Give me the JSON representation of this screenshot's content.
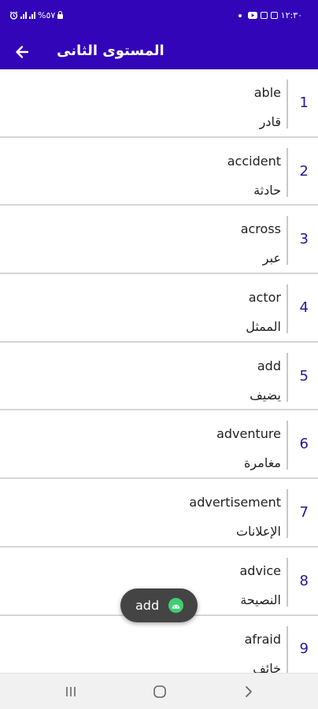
{
  "statusbar": {
    "time": "١٢:٣٠",
    "battery": "%٥٧",
    "icons": [
      "alarm-icon",
      "signal-icon",
      "signal-icon",
      "lock-icon",
      "gallery-icon",
      "instagram-icon",
      "youtube-icon",
      "notification-dot-icon"
    ]
  },
  "appbar": {
    "title": "المستوى الثانى",
    "back_icon": "arrow-left-icon",
    "background": "#3305b9"
  },
  "words": [
    {
      "num": "1",
      "en": "able",
      "ar": "قادر"
    },
    {
      "num": "2",
      "en": "accident",
      "ar": "حادثة"
    },
    {
      "num": "3",
      "en": "across",
      "ar": "عبر"
    },
    {
      "num": "4",
      "en": "actor",
      "ar": "الممثل"
    },
    {
      "num": "5",
      "en": "add",
      "ar": "يضيف"
    },
    {
      "num": "6",
      "en": "adventure",
      "ar": "مغامرة"
    },
    {
      "num": "7",
      "en": "advertisement",
      "ar": "الإعلانات"
    },
    {
      "num": "8",
      "en": "advice",
      "ar": "النصيحة"
    },
    {
      "num": "9",
      "en": "afraid",
      "ar": "خائف"
    }
  ],
  "fab": {
    "label": "add",
    "icon": "android-icon",
    "background": "#444444",
    "icon_color": "#3ecf72"
  },
  "navbar": {
    "items": [
      "recent-apps-icon",
      "home-icon",
      "back-chevron-icon"
    ]
  },
  "colors": {
    "accent": "#3305b9",
    "number": "#27159b"
  }
}
